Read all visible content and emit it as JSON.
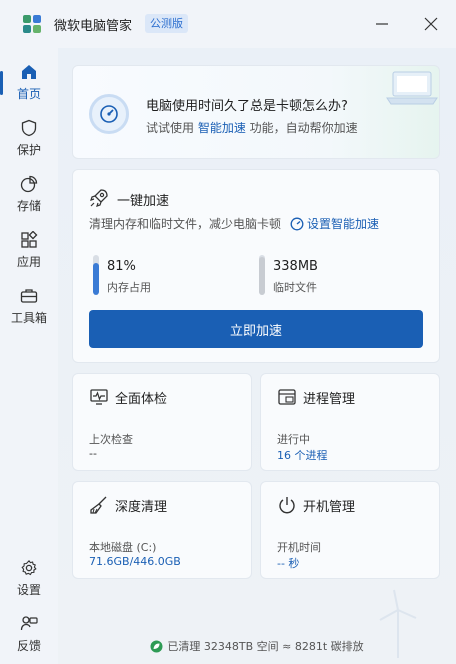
{
  "app": {
    "title": "微软电脑管家",
    "badge": "公测版"
  },
  "sidebar": {
    "items": [
      {
        "label": "首页",
        "icon": "home-icon",
        "active": true
      },
      {
        "label": "保护",
        "icon": "shield-icon",
        "active": false
      },
      {
        "label": "存储",
        "icon": "pie-chart-icon",
        "active": false
      },
      {
        "label": "应用",
        "icon": "apps-icon",
        "active": false
      },
      {
        "label": "工具箱",
        "icon": "toolbox-icon",
        "active": false
      }
    ],
    "bottom": [
      {
        "label": "设置",
        "icon": "gear-icon"
      },
      {
        "label": "反馈",
        "icon": "feedback-icon"
      }
    ]
  },
  "banner": {
    "question": "电脑使用时间久了总是卡顿怎么办?",
    "sub_prefix": "试试使用 ",
    "sub_link": "智能加速",
    "sub_suffix": " 功能，自动帮你加速"
  },
  "speedup": {
    "title": "一键加速",
    "desc": "清理内存和临时文件，减少电脑卡顿",
    "smart_link": "设置智能加速",
    "memory": {
      "value": "81%",
      "label": "内存占用",
      "fraction": 0.81
    },
    "temp": {
      "value": "338MB",
      "label": "临时文件",
      "fraction": 0.95
    },
    "button": "立即加速"
  },
  "tiles": {
    "checkup": {
      "title": "全面体检",
      "label": "上次检查",
      "value": "--"
    },
    "process": {
      "title": "进程管理",
      "label": "进行中",
      "value": "16 个进程"
    },
    "clean": {
      "title": "深度清理",
      "label": "本地磁盘 (C:)",
      "value": "71.6GB/446.0GB"
    },
    "startup": {
      "title": "开机管理",
      "label": "开机时间",
      "value": "-- 秒"
    }
  },
  "footer": {
    "text": "已清理 32348TB 空间 ≈ 8281t 碳排放"
  },
  "colors": {
    "accent": "#1a5fb4",
    "meter_fill": "#3a7bd5",
    "meter_track": "#d9dee5",
    "leaf": "#2e9b55"
  }
}
